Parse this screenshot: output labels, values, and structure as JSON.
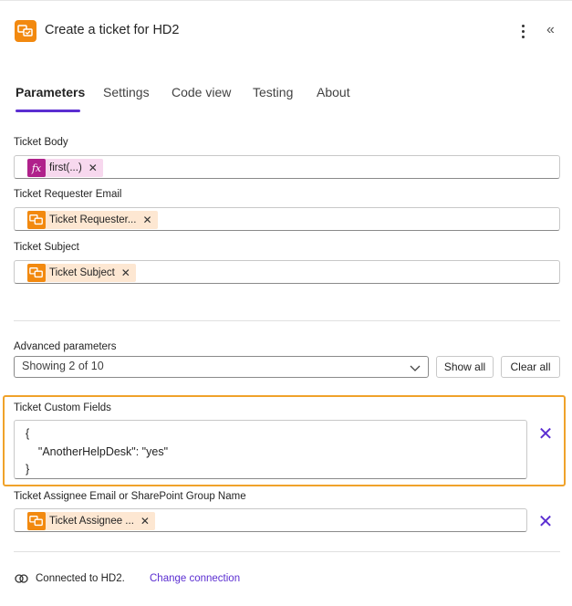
{
  "header": {
    "title": "Create a ticket for HD2",
    "app_icon": "helpdesk-app-icon",
    "more_icon": "more-vertical-icon",
    "collapse_icon": "double-chevron-left-icon",
    "collapse_glyph": "«"
  },
  "tabs": [
    {
      "label": "Parameters",
      "active": true
    },
    {
      "label": "Settings",
      "active": false
    },
    {
      "label": "Code view",
      "active": false
    },
    {
      "label": "Testing",
      "active": false
    },
    {
      "label": "About",
      "active": false
    }
  ],
  "fields": {
    "ticket_body": {
      "label": "Ticket Body",
      "token_label": "first(...)",
      "token_icon": "fx"
    },
    "requester_email": {
      "label": "Ticket Requester Email",
      "token_label": "Ticket Requester..."
    },
    "subject": {
      "label": "Ticket Subject",
      "token_label": "Ticket Subject"
    }
  },
  "advanced": {
    "label": "Advanced parameters",
    "selected": "Showing 2 of 10",
    "show_all": "Show all",
    "clear_all": "Clear all"
  },
  "custom_fields": {
    "label": "Ticket Custom Fields",
    "lines": [
      "{",
      "    \"AnotherHelpDesk\": \"yes\"",
      "}"
    ]
  },
  "assignee": {
    "label": "Ticket Assignee Email or SharePoint Group Name",
    "token_label": "Ticket Assignee ..."
  },
  "footer": {
    "connected_text": "Connected to HD2.",
    "change_link": "Change connection",
    "connection_icon": "link-icon"
  },
  "colors": {
    "accent": "#5b2ed1",
    "app_orange": "#f2890f",
    "highlight": "#f0a22a",
    "fx_magenta": "#b0218b"
  },
  "remove_glyph": "✕",
  "token_remove_glyph": "✕"
}
